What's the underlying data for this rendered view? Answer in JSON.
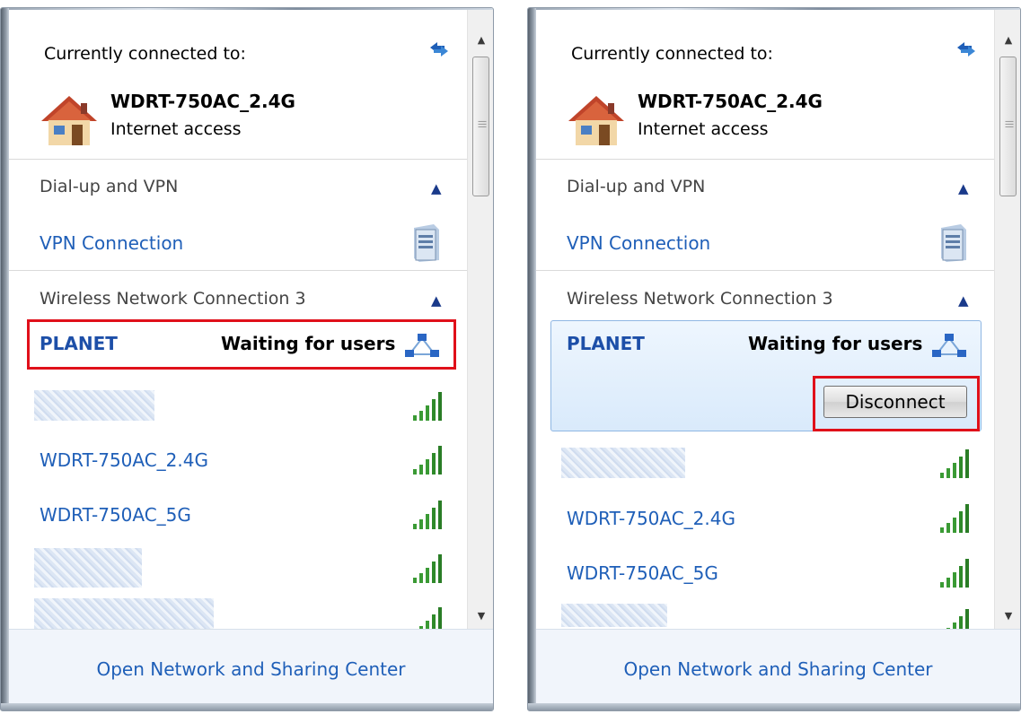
{
  "panels": [
    {
      "current_label": "Currently connected to:",
      "current_network": "WDRT-750AC_2.4G",
      "current_status": "Internet access",
      "group_vpn": "Dial-up and VPN",
      "vpn_name": "VPN Connection",
      "group_wireless": "Wireless Network Connection 3",
      "selected_name": "PLANET",
      "selected_status": "Waiting for users",
      "network_1": "WDRT-750AC_2.4G",
      "network_2": "WDRT-750AC_5G",
      "footer_link": "Open Network and Sharing Center"
    },
    {
      "current_label": "Currently connected to:",
      "current_network": "WDRT-750AC_2.4G",
      "current_status": "Internet access",
      "group_vpn": "Dial-up and VPN",
      "vpn_name": "VPN Connection",
      "group_wireless": "Wireless Network Connection 3",
      "selected_name": "PLANET",
      "selected_status": "Waiting for users",
      "disconnect_label": "Disconnect",
      "network_1": "WDRT-750AC_2.4G",
      "network_2": "WDRT-750AC_5G",
      "footer_link": "Open Network and Sharing Center"
    }
  ],
  "icons": {
    "refresh": "refresh-icon",
    "house": "house-icon",
    "chevron": "chevron-up-icon",
    "server": "vpn-server-icon",
    "adhoc": "adhoc-network-icon",
    "signal": "signal-strength-icon"
  },
  "colors": {
    "link": "#1f5fb8",
    "highlight": "#e0101a",
    "signal": "#2f9a2f"
  }
}
